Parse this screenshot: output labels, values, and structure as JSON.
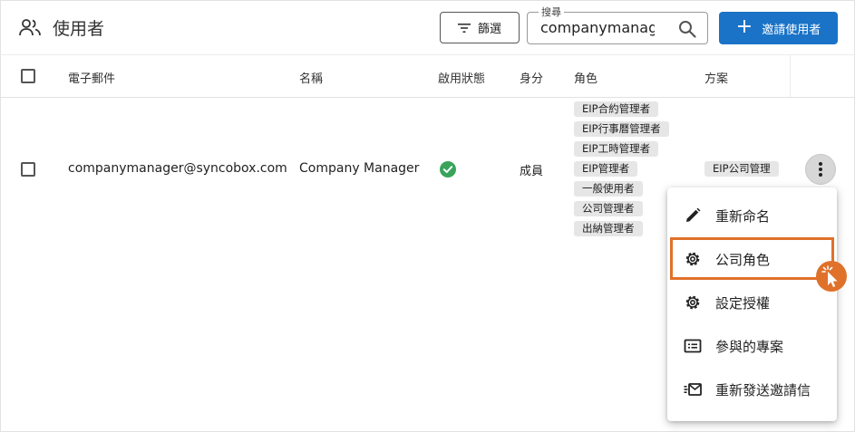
{
  "header": {
    "title": "使用者",
    "filter_label": "篩選",
    "search_legend": "搜尋",
    "search_value": "companymanager",
    "invite_label": "邀請使用者"
  },
  "table": {
    "columns": [
      "電子郵件",
      "名稱",
      "啟用狀態",
      "身分",
      "角色",
      "方案"
    ],
    "rows": [
      {
        "email": "companymanager@syncobox.com",
        "name": "Company Manager",
        "status": "enabled",
        "identity": "成員",
        "roles": [
          "EIP合約管理者",
          "EIP行事曆管理者",
          "EIP工時管理者",
          "EIP管理者",
          "一般使用者",
          "公司管理者",
          "出納管理者"
        ],
        "plan": "EIP公司管理"
      }
    ]
  },
  "menu": {
    "items": [
      {
        "label": "重新命名",
        "icon": "pencil-icon"
      },
      {
        "label": "公司角色",
        "icon": "gear-icon",
        "highlighted": true
      },
      {
        "label": "設定授權",
        "icon": "gear-icon"
      },
      {
        "label": "參與的專案",
        "icon": "project-list-icon"
      },
      {
        "label": "重新發送邀請信",
        "icon": "send-mail-icon"
      }
    ]
  },
  "colors": {
    "primary": "#1a73c7",
    "highlight": "#e0712a",
    "success": "#3aa35a",
    "chip": "#e6e6e6"
  }
}
